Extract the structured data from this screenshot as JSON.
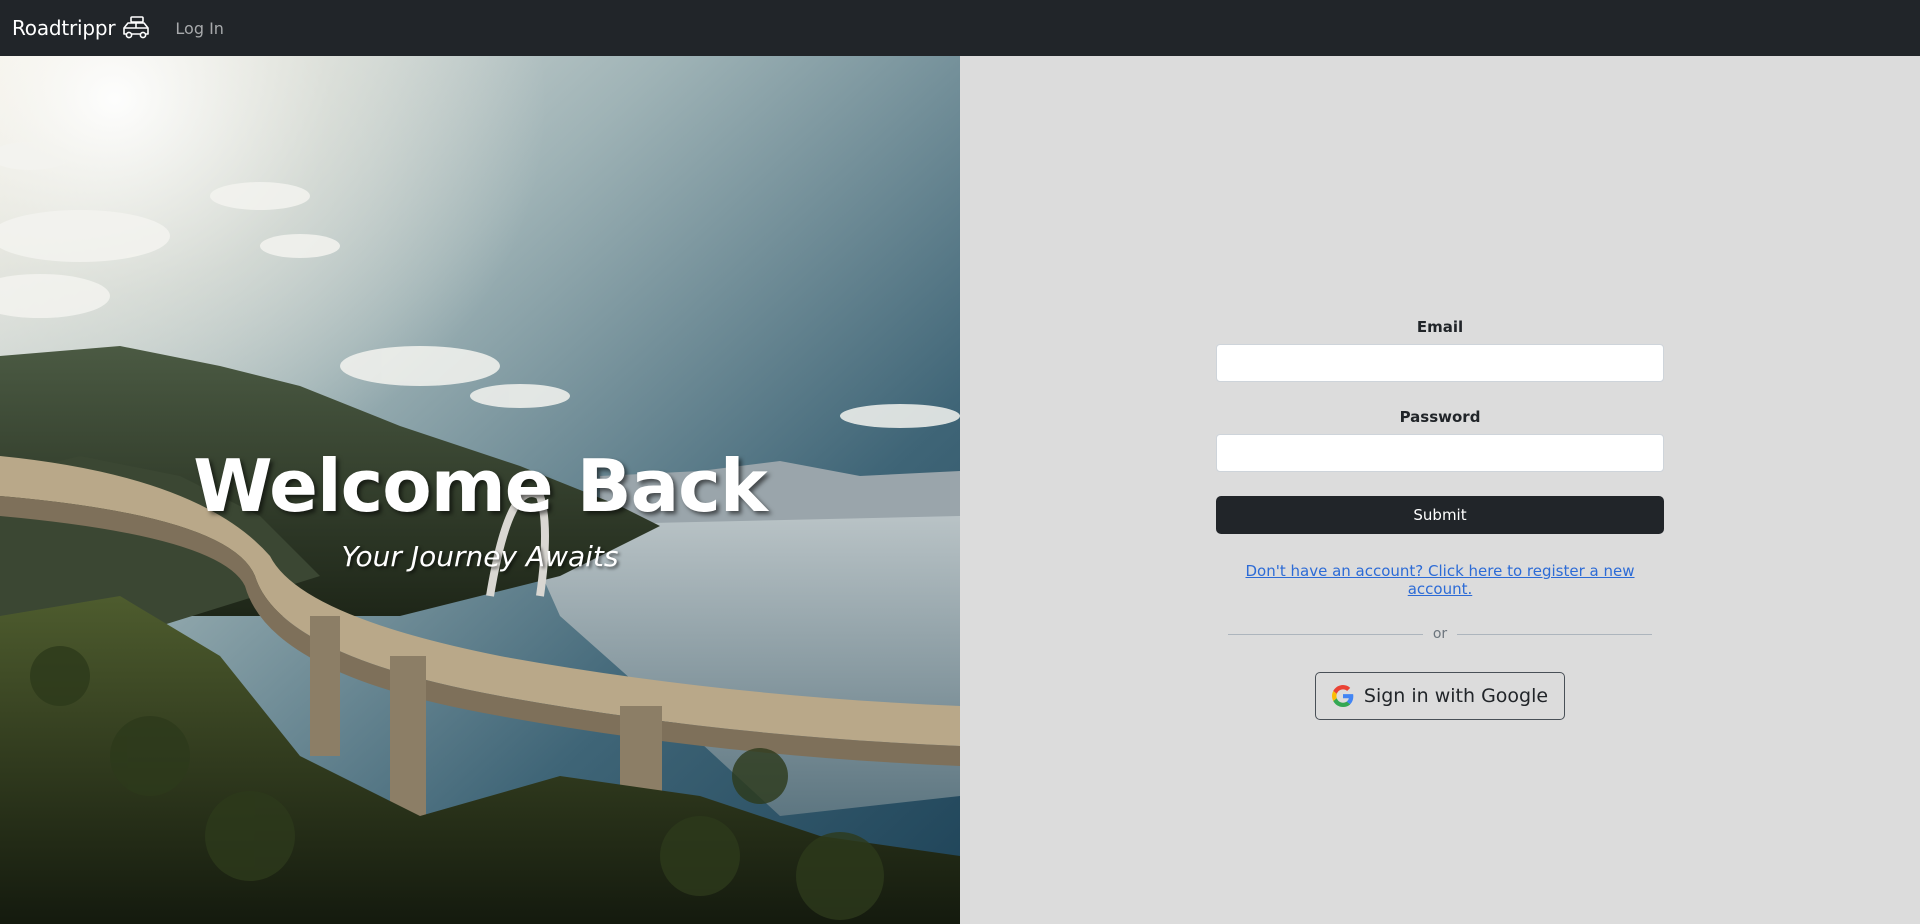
{
  "navbar": {
    "brand": "Roadtrippr",
    "brand_icon": "car-icon",
    "login_link": "Log In",
    "background": "#212529"
  },
  "hero": {
    "title": "Welcome Back",
    "subtitle": "Your Journey Awaits"
  },
  "form": {
    "email_label": "Email",
    "email_value": "",
    "password_label": "Password",
    "password_value": "",
    "submit_label": "Submit",
    "register_link": "Don't have an account? Click here to register a new account.",
    "divider_text": "or",
    "google_label": "Sign in with Google",
    "google_icon": "google-icon"
  },
  "colors": {
    "panel_background": "#dcdcdc",
    "button_dark": "#212529",
    "link_blue": "#2c6bd6"
  }
}
